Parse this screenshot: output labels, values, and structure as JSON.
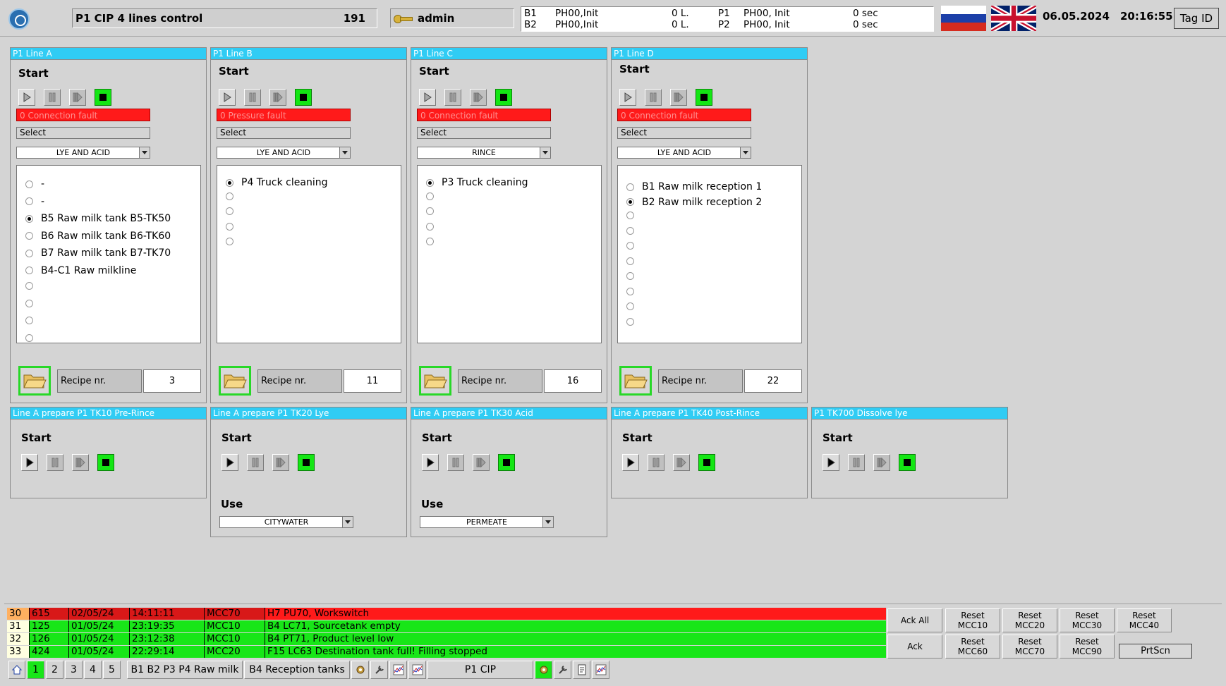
{
  "header": {
    "title": "P1 CIP 4 lines control",
    "title_number": "191",
    "user": "admin",
    "status": [
      {
        "id": "B1",
        "state": "PH00,Init",
        "amount": "0 L.",
        "pid": "P1",
        "pstate": "PH00, Init",
        "time": "0 sec"
      },
      {
        "id": "B2",
        "state": "PH00,Init",
        "amount": "0 L.",
        "pid": "P2",
        "pstate": "PH00, Init",
        "time": "0 sec"
      }
    ],
    "date": "06.05.2024",
    "time": "20:16:55",
    "tag_button": "Tag ID",
    "flag_colors": {
      "ru_white": "#ffffff",
      "ru_blue": "#1c3fa8",
      "ru_red": "#d52b1e",
      "uk_blue": "#012169",
      "uk_red": "#c8102e"
    }
  },
  "lines": [
    {
      "title": "P1 Line A",
      "start_label": "Start",
      "fault": "0 Connection fault",
      "select": "Select",
      "program": "LYE AND ACID",
      "items": [
        {
          "label": "-",
          "selected": false
        },
        {
          "label": "-",
          "selected": false
        },
        {
          "label": "B5 Raw milk tank B5-TK50",
          "selected": true
        },
        {
          "label": "B6 Raw milk tank B6-TK60",
          "selected": false
        },
        {
          "label": "B7 Raw milk tank B7-TK70",
          "selected": false
        },
        {
          "label": "B4-C1 Raw milkline",
          "selected": false
        },
        {
          "label": "",
          "selected": false
        },
        {
          "label": "",
          "selected": false
        },
        {
          "label": "",
          "selected": false
        },
        {
          "label": "",
          "selected": false
        }
      ],
      "recipe_label": "Recipe nr.",
      "recipe_value": "3"
    },
    {
      "title": "P1 Line B",
      "start_label": "Start",
      "fault": "0 Pressure fault",
      "select": "Select",
      "program": "LYE AND ACID",
      "items": [
        {
          "label": "P4 Truck cleaning",
          "selected": true
        },
        {
          "label": "",
          "selected": false
        },
        {
          "label": "",
          "selected": false
        },
        {
          "label": "",
          "selected": false
        },
        {
          "label": "",
          "selected": false
        }
      ],
      "recipe_label": "Recipe nr.",
      "recipe_value": "11"
    },
    {
      "title": "P1 Line C",
      "start_label": "Start",
      "fault": "0 Connection fault",
      "select": "Select",
      "program": "RINCE",
      "items": [
        {
          "label": "P3 Truck cleaning",
          "selected": true
        },
        {
          "label": "",
          "selected": false
        },
        {
          "label": "",
          "selected": false
        },
        {
          "label": "",
          "selected": false
        },
        {
          "label": "",
          "selected": false
        }
      ],
      "recipe_label": "Recipe nr.",
      "recipe_value": "16"
    },
    {
      "title": "P1 Line D",
      "start_label": "Start",
      "fault": "0 Connection fault",
      "select": "Select",
      "program": "LYE AND ACID",
      "items": [
        {
          "label": "B1 Raw milk reception 1",
          "selected": false
        },
        {
          "label": "B2 Raw milk reception 2",
          "selected": true
        },
        {
          "label": "",
          "selected": false
        },
        {
          "label": "",
          "selected": false
        },
        {
          "label": "",
          "selected": false
        },
        {
          "label": "",
          "selected": false
        },
        {
          "label": "",
          "selected": false
        },
        {
          "label": "",
          "selected": false
        },
        {
          "label": "",
          "selected": false
        },
        {
          "label": "",
          "selected": false
        }
      ],
      "recipe_label": "Recipe nr.",
      "recipe_value": "22"
    }
  ],
  "prepare": [
    {
      "title": "Line A prepare P1 TK10 Pre-Rince",
      "start_label": "Start"
    },
    {
      "title": "Line A prepare P1 TK20 Lye",
      "start_label": "Start",
      "use_label": "Use",
      "use_value": "CITYWATER"
    },
    {
      "title": "Line A prepare P1 TK30 Acid",
      "start_label": "Start",
      "use_label": "Use",
      "use_value": "PERMEATE"
    },
    {
      "title": "Line A prepare P1 TK40 Post-Rince",
      "start_label": "Start"
    },
    {
      "title": "P1 TK700 Dissolve lye",
      "start_label": "Start"
    }
  ],
  "alarms": [
    {
      "nr": "30",
      "code": "615",
      "date": "02/05/24",
      "time": "14:11:11",
      "mcc": "MCC70",
      "text": "H7 PU70, Workswitch",
      "color": "#ff1a1a",
      "nr_color": "#ffb060",
      "cell_color": "#d81818"
    },
    {
      "nr": "31",
      "code": "125",
      "date": "01/05/24",
      "time": "23:19:35",
      "mcc": "MCC10",
      "text": "B4 LC71, Sourcetank empty",
      "color": "#18e618",
      "nr_color": "#ffffe0",
      "cell_color": "#18e618"
    },
    {
      "nr": "32",
      "code": "126",
      "date": "01/05/24",
      "time": "23:12:38",
      "mcc": "MCC10",
      "text": "B4 PT71, Product level low",
      "color": "#18e618",
      "nr_color": "#ffffe0",
      "cell_color": "#18e618"
    },
    {
      "nr": "33",
      "code": "424",
      "date": "01/05/24",
      "time": "22:29:14",
      "mcc": "MCC20",
      "text": "F15 LC63 Destination tank full! Filling stopped",
      "color": "#18e618",
      "nr_color": "#ffffe0",
      "cell_color": "#18e618"
    }
  ],
  "alarm_buttons": {
    "ack_all": "Ack All",
    "ack": "Ack",
    "reset_label": "Reset",
    "resets_top": [
      "MCC10",
      "MCC20",
      "MCC30",
      "MCC40"
    ],
    "resets_bottom": [
      "MCC60",
      "MCC70",
      "MCC90"
    ],
    "prtscn": "PrtScn"
  },
  "nav": {
    "pages": [
      "1",
      "2",
      "3",
      "4",
      "5"
    ],
    "active_page": "1",
    "screen1": "B1 B2 P3 P4 Raw milk",
    "screen2": "B4 Reception tanks",
    "screen3": "P1 CIP",
    "icons": [
      "home-icon",
      "settings-icon",
      "wrench-icon",
      "trend-icon",
      "trend-icon",
      "settings-icon",
      "wrench-icon",
      "report-icon",
      "trend-icon"
    ]
  },
  "colors": {
    "header_cyan": "#30ccf4",
    "fault_red": "#ff1a1a",
    "ok_green": "#18e618",
    "bg": "#d4d4d4"
  }
}
